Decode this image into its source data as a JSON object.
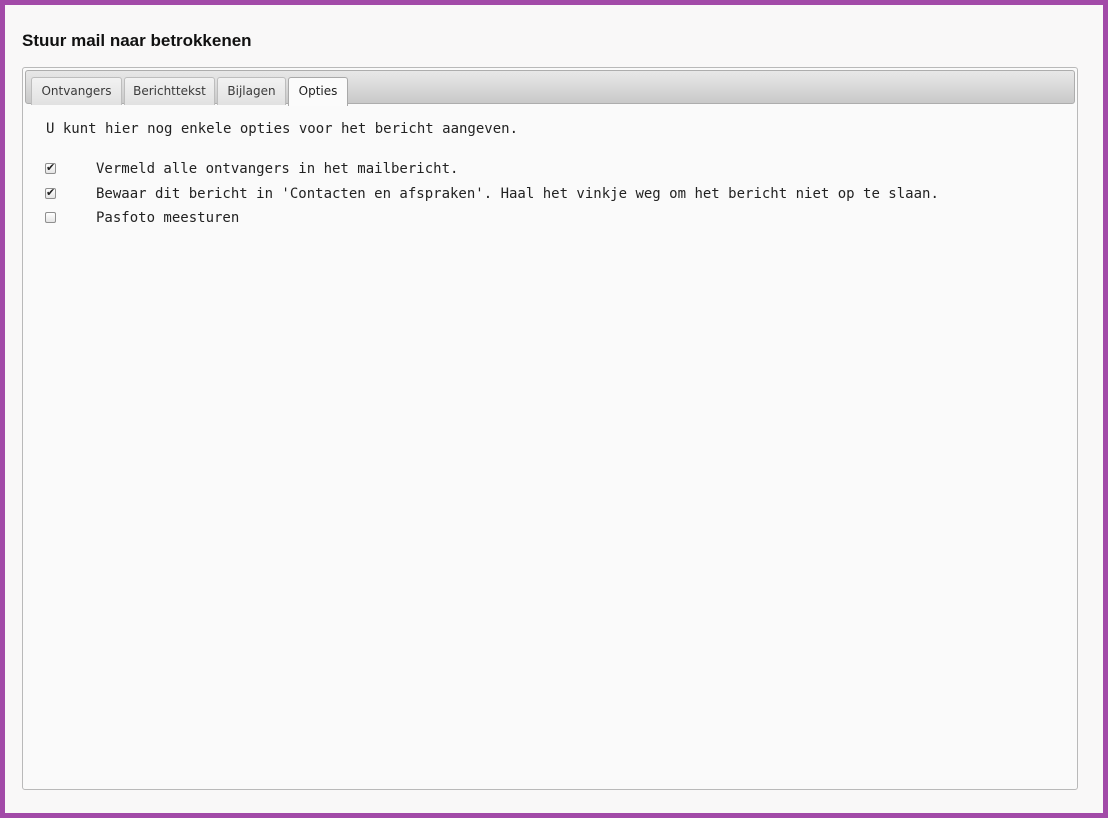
{
  "dialog": {
    "title": "Stuur mail naar betrokkenen"
  },
  "tabs": [
    {
      "label": "Ontvangers",
      "active": false
    },
    {
      "label": "Berichttekst",
      "active": false
    },
    {
      "label": "Bijlagen",
      "active": false
    },
    {
      "label": "Opties",
      "active": true
    }
  ],
  "options_panel": {
    "intro": "U kunt hier nog enkele opties voor het bericht aangeven.",
    "options": [
      {
        "label": "Vermeld alle ontvangers in het mailbericht.",
        "checked": true
      },
      {
        "label": "Bewaar dit bericht in 'Contacten en afspraken'. Haal het vinkje weg om het bericht niet op te slaan.",
        "checked": true
      },
      {
        "label": "Pasfoto meesturen",
        "checked": false
      }
    ]
  },
  "colors": {
    "frame": "#a24aa8",
    "background": "#f9f8f8"
  },
  "icons": {
    "checkmark": "check-mark-icon"
  }
}
